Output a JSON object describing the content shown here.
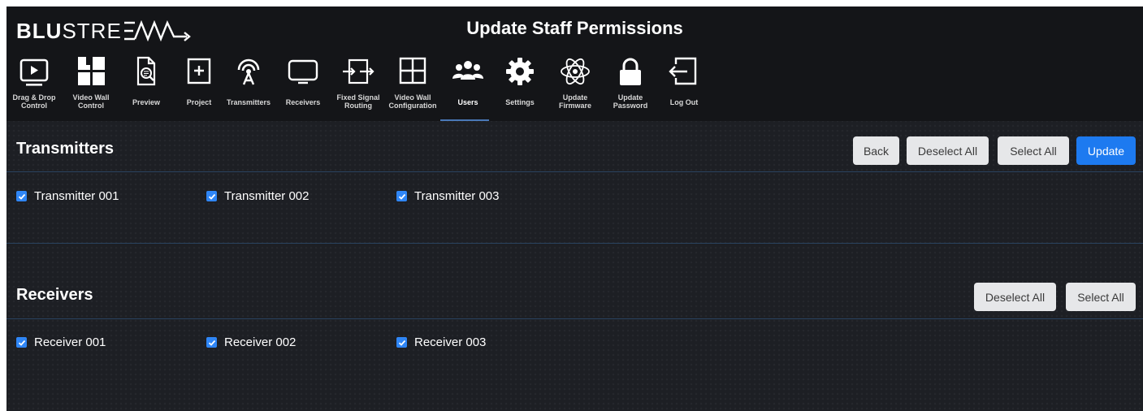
{
  "brand": {
    "bold": "BLU",
    "light": "STREAM"
  },
  "header": {
    "title": "Update Staff Permissions"
  },
  "nav": {
    "items": [
      {
        "label_lines": [
          "Drag & Drop",
          "Control"
        ],
        "icon": "drag-drop-control-icon"
      },
      {
        "label_lines": [
          "Video Wall",
          "Control"
        ],
        "icon": "video-wall-control-icon"
      },
      {
        "label_lines": [
          "Preview"
        ],
        "icon": "preview-icon"
      },
      {
        "label_lines": [
          "Project"
        ],
        "icon": "project-icon"
      },
      {
        "label_lines": [
          "Transmitters"
        ],
        "icon": "transmitters-icon"
      },
      {
        "label_lines": [
          "Receivers"
        ],
        "icon": "receivers-icon"
      },
      {
        "label_lines": [
          "Fixed Signal",
          "Routing"
        ],
        "icon": "fixed-signal-routing-icon"
      },
      {
        "label_lines": [
          "Video Wall",
          "Configuration"
        ],
        "icon": "video-wall-configuration-icon"
      },
      {
        "label_lines": [
          "Users"
        ],
        "icon": "users-icon",
        "active": true
      },
      {
        "label_lines": [
          "Settings"
        ],
        "icon": "settings-icon"
      },
      {
        "label_lines": [
          "Update",
          "Firmware"
        ],
        "icon": "update-firmware-icon"
      },
      {
        "label_lines": [
          "Update",
          "Password"
        ],
        "icon": "update-password-icon"
      },
      {
        "label_lines": [
          "Log Out"
        ],
        "icon": "log-out-icon"
      }
    ]
  },
  "transmitters": {
    "title": "Transmitters",
    "buttons": {
      "back": "Back",
      "deselect_all": "Deselect All",
      "select_all": "Select All",
      "update": "Update"
    },
    "items": [
      {
        "label": "Transmitter 001",
        "checked": true
      },
      {
        "label": "Transmitter 002",
        "checked": true
      },
      {
        "label": "Transmitter 003",
        "checked": true
      }
    ]
  },
  "receivers": {
    "title": "Receivers",
    "buttons": {
      "deselect_all": "Deselect All",
      "select_all": "Select All"
    },
    "items": [
      {
        "label": "Receiver 001",
        "checked": true
      },
      {
        "label": "Receiver 002",
        "checked": true
      },
      {
        "label": "Receiver 003",
        "checked": true
      }
    ]
  },
  "colors": {
    "accent": "#1d7af0",
    "checkbox": "#2f86f6",
    "background": "#1d1f24",
    "topbar": "#141518"
  }
}
